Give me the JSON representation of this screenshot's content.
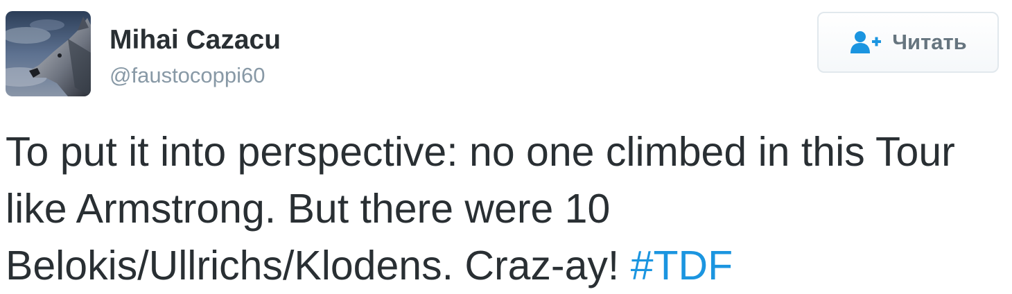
{
  "user": {
    "display_name": "Mihai Cazacu",
    "handle": "@faustocoppi60",
    "avatar_icon": "wolf-avatar-image"
  },
  "follow_button": {
    "label": "Читать",
    "icon": "follow-user-plus-icon"
  },
  "tweet": {
    "text": "To put it into perspective: no one climbed in this Tour like Armstrong. But there were 10 Belokis/Ullrichs/Klodens. Craz-ay! ",
    "hashtag": "#TDF"
  },
  "colors": {
    "text": "#292f33",
    "handle": "#8899a6",
    "link": "#1b95e0",
    "follow_icon": "#1b95e0",
    "button_border": "#e1e8ed"
  }
}
